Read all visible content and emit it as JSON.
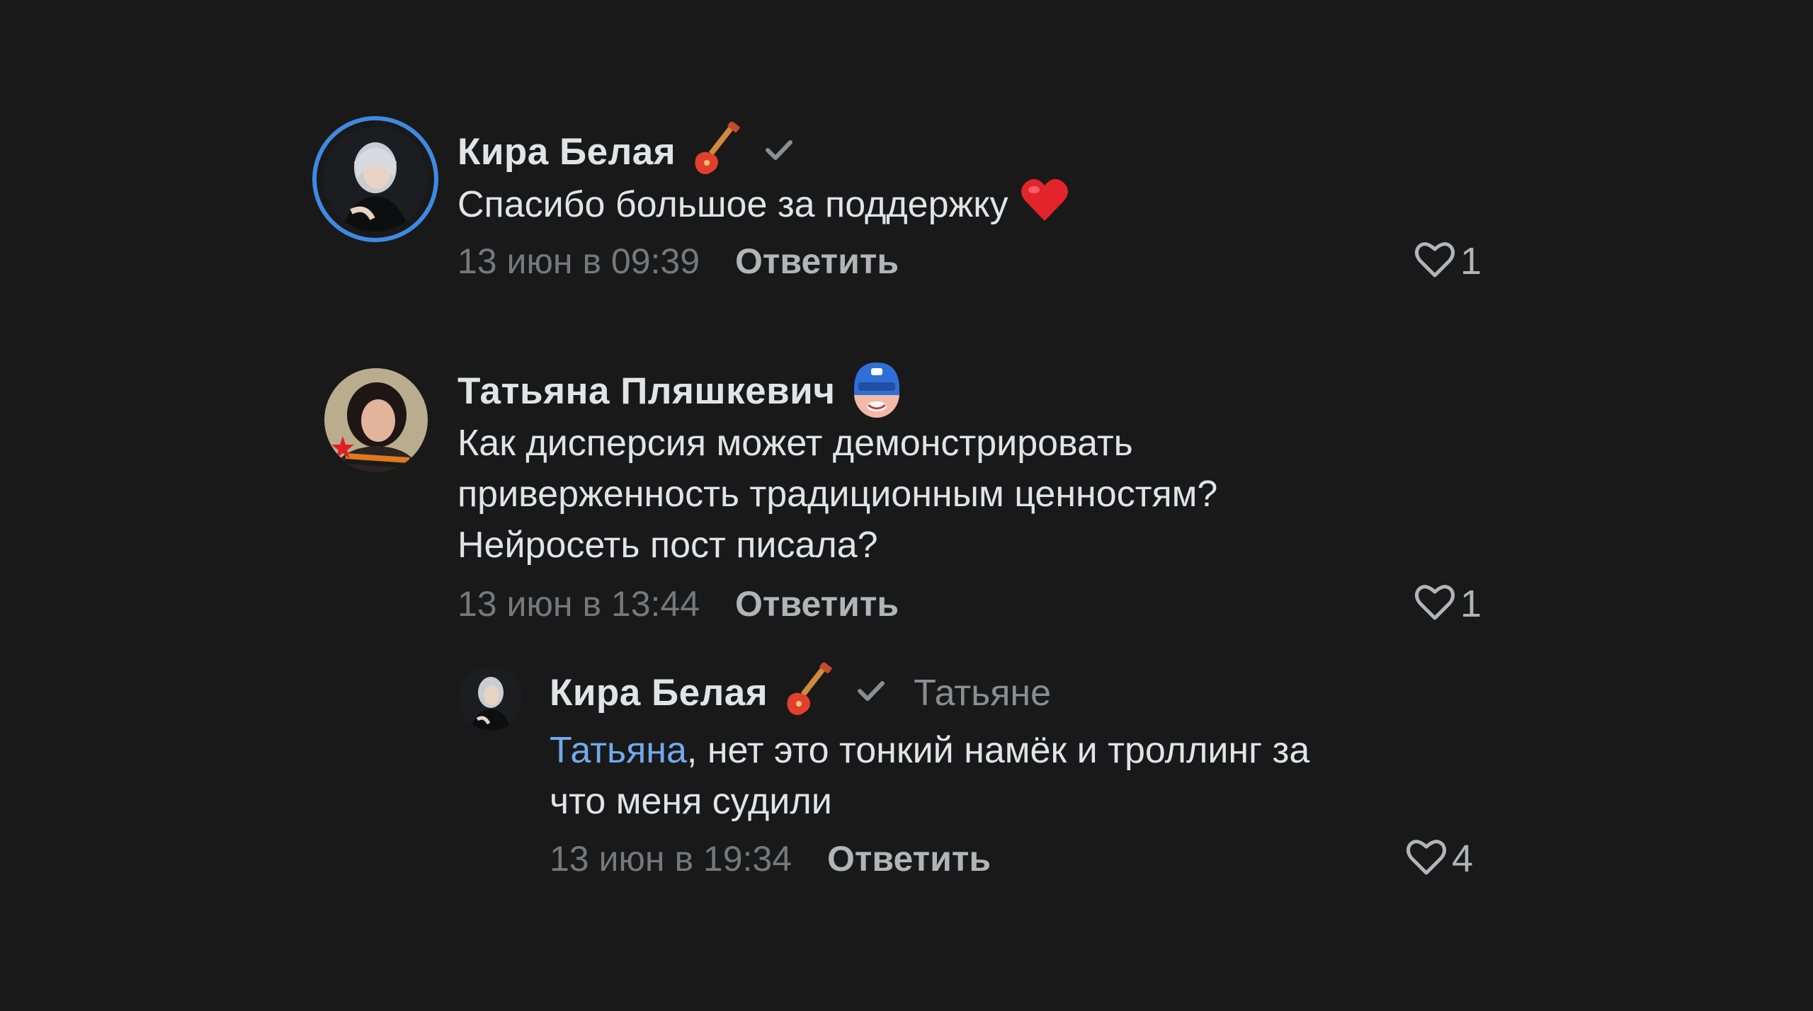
{
  "comments": [
    {
      "author": "Кира Белая",
      "badge_icon": "electric-guitar-emoji",
      "verified": true,
      "text_lines": [
        "Спасибо большое за поддержку"
      ],
      "text_emoji": "red-heart-emoji",
      "timestamp": "13 июн в 09:39",
      "reply_label": "Ответить",
      "like_icon": "heart-outline-icon",
      "likes": "1",
      "avatar_ring_color": "#3f8ae0"
    },
    {
      "author": "Татьяна Пляшкевич",
      "badge_icon": "masked-hero-emoji",
      "text_lines": [
        "Как дисперсия может демонстрировать",
        "приверженность традиционным ценностям?",
        "Нейросеть пост писала?"
      ],
      "timestamp": "13 июн в 13:44",
      "reply_label": "Ответить",
      "like_icon": "heart-outline-icon",
      "likes": "1"
    },
    {
      "author": "Кира Белая",
      "badge_icon": "electric-guitar-emoji",
      "verified": true,
      "reply_to": "Татьяне",
      "mention": "Татьяна",
      "text_lines": [
        ", нет это тонкий намёк и троллинг за",
        "что меня судили"
      ],
      "timestamp": "13 июн в 19:34",
      "reply_label": "Ответить",
      "like_icon": "heart-outline-icon",
      "likes": "4"
    }
  ],
  "colors": {
    "background": "#19191a",
    "text_primary": "#e1e3e6",
    "text_secondary": "#76787a",
    "action": "#b2b4b7",
    "link": "#71aaeb",
    "avatar_ring": "#3f8ae0"
  }
}
